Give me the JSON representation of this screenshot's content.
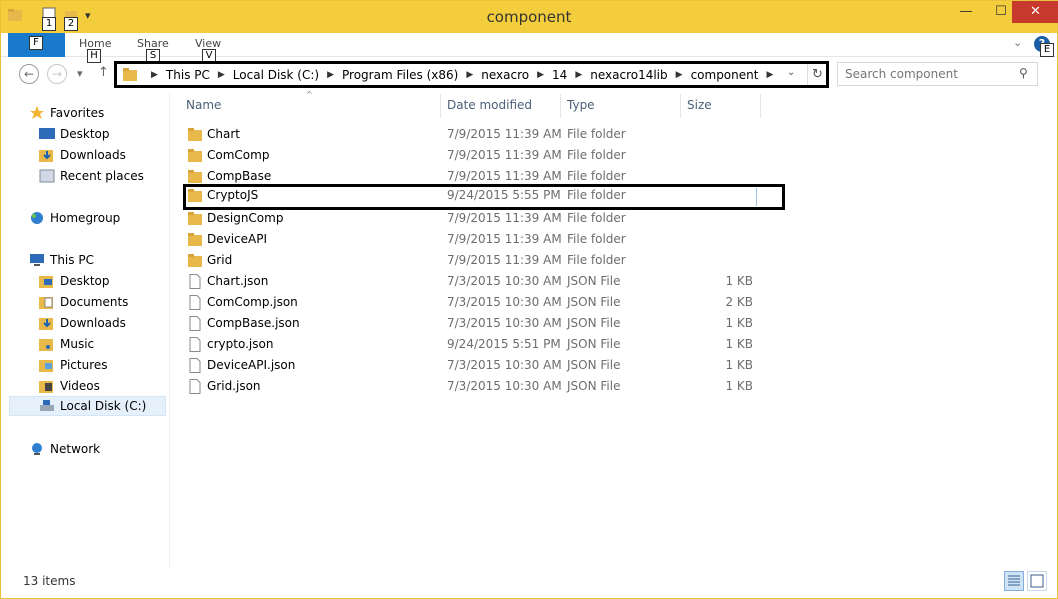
{
  "window": {
    "title": "component",
    "minimize": "—",
    "maximize": "☐",
    "close": "✕"
  },
  "quick_access": {
    "keytip_1": "1",
    "keytip_2": "2",
    "dropdown": "▾"
  },
  "ribbon": {
    "file_label": "F",
    "tabs": [
      {
        "label": "Home",
        "keytip": "H"
      },
      {
        "label": "Share",
        "keytip": "S"
      },
      {
        "label": "View",
        "keytip": "V"
      }
    ],
    "help_label": "?",
    "help_keytip": "E",
    "expand": "⌄"
  },
  "nav_buttons": {
    "back": "←",
    "forward": "→",
    "recent": "▾",
    "up": "↑"
  },
  "address": {
    "crumbs": [
      "This PC",
      "Local Disk (C:)",
      "Program Files (x86)",
      "nexacro",
      "14",
      "nexacro14lib",
      "component"
    ],
    "separator": "▶",
    "dropdown": "⌄",
    "refresh": "↻"
  },
  "search": {
    "placeholder": "Search component",
    "icon": "⚲"
  },
  "nav_pane": {
    "favorites": {
      "label": "Favorites",
      "items": [
        "Desktop",
        "Downloads",
        "Recent places"
      ]
    },
    "homegroup": {
      "label": "Homegroup"
    },
    "this_pc": {
      "label": "This PC",
      "items": [
        "Desktop",
        "Documents",
        "Downloads",
        "Music",
        "Pictures",
        "Videos",
        "Local Disk (C:)"
      ]
    },
    "network": {
      "label": "Network"
    }
  },
  "columns": {
    "name": "Name",
    "date": "Date modified",
    "type": "Type",
    "size": "Size",
    "sort_indicator": "^"
  },
  "files": [
    {
      "name": "Chart",
      "date": "7/9/2015 11:39 AM",
      "type": "File folder",
      "size": "",
      "kind": "folder"
    },
    {
      "name": "ComComp",
      "date": "7/9/2015 11:39 AM",
      "type": "File folder",
      "size": "",
      "kind": "folder"
    },
    {
      "name": "CompBase",
      "date": "7/9/2015 11:39 AM",
      "type": "File folder",
      "size": "",
      "kind": "folder"
    },
    {
      "name": "CryptoJS",
      "date": "9/24/2015 5:55 PM",
      "type": "File folder",
      "size": "",
      "kind": "folder"
    },
    {
      "name": "DesignComp",
      "date": "7/9/2015 11:39 AM",
      "type": "File folder",
      "size": "",
      "kind": "folder"
    },
    {
      "name": "DeviceAPI",
      "date": "7/9/2015 11:39 AM",
      "type": "File folder",
      "size": "",
      "kind": "folder"
    },
    {
      "name": "Grid",
      "date": "7/9/2015 11:39 AM",
      "type": "File folder",
      "size": "",
      "kind": "folder"
    },
    {
      "name": "Chart.json",
      "date": "7/3/2015 10:30 AM",
      "type": "JSON File",
      "size": "1 KB",
      "kind": "file"
    },
    {
      "name": "ComComp.json",
      "date": "7/3/2015 10:30 AM",
      "type": "JSON File",
      "size": "2 KB",
      "kind": "file"
    },
    {
      "name": "CompBase.json",
      "date": "7/3/2015 10:30 AM",
      "type": "JSON File",
      "size": "1 KB",
      "kind": "file"
    },
    {
      "name": "crypto.json",
      "date": "9/24/2015 5:51 PM",
      "type": "JSON File",
      "size": "1 KB",
      "kind": "file"
    },
    {
      "name": "DeviceAPI.json",
      "date": "7/3/2015 10:30 AM",
      "type": "JSON File",
      "size": "1 KB",
      "kind": "file"
    },
    {
      "name": "Grid.json",
      "date": "7/3/2015 10:30 AM",
      "type": "JSON File",
      "size": "1 KB",
      "kind": "file"
    }
  ],
  "status": {
    "item_count": "13 items"
  },
  "colors": {
    "titlebar": "#f4cd3c",
    "file_tab": "#1979ca",
    "close": "#c7392c",
    "folder": "#e8b94a",
    "selection": "#e5f0fb"
  }
}
